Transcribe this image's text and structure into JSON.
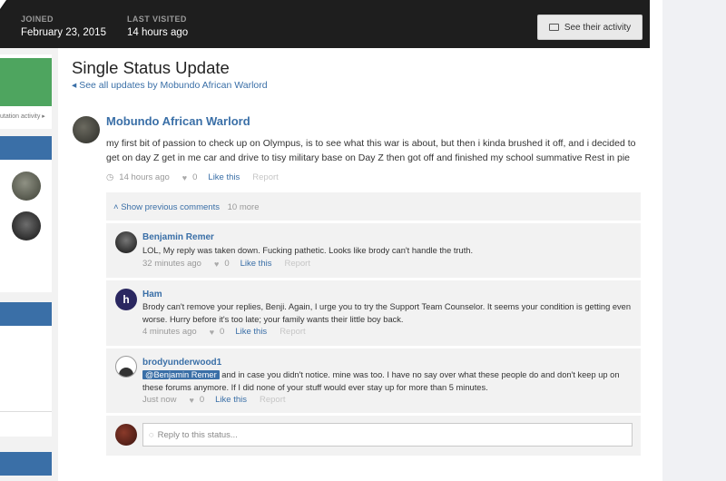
{
  "header": {
    "joined_label": "JOINED",
    "joined_value": "February 23, 2015",
    "last_visited_label": "LAST VISITED",
    "last_visited_value": "14 hours ago",
    "activity_button": "See their activity"
  },
  "sidebar": {
    "reputation_link": "utation activity ▸"
  },
  "page": {
    "title": "Single Status Update",
    "back_link": "◂ See all updates by Mobundo African Warlord"
  },
  "status": {
    "author": "Mobundo African Warlord",
    "text": "my first bit of passion to check up on Olympus, is to see what this war is about, but then i kinda brushed it off, and i decided to get on day Z  get in me car and drive to tisy military base on Day Z then got off  and finished my school summative Rest in pie",
    "time": "14 hours ago",
    "likes": "0",
    "like_label": "Like this",
    "report_label": "Report"
  },
  "comments": {
    "show_previous": "Show previous comments",
    "more_count": "10 more",
    "items": [
      {
        "author": "Benjamin Remer",
        "text": "LOL, My reply was taken down. Fucking pathetic. Looks like brody can't handle the truth.",
        "time": "32 minutes ago",
        "likes": "0",
        "like_label": "Like this",
        "report_label": "Report"
      },
      {
        "author": "Ham",
        "avatar_letter": "h",
        "text": "Brody can't remove your replies, Benji. Again, I urge you to try the Support Team Counselor. It seems your condition is getting even worse. Hurry before it's too late; your family wants their little boy back.",
        "time": "4 minutes ago",
        "likes": "0",
        "like_label": "Like this",
        "report_label": "Report"
      },
      {
        "author": "brodyunderwood1",
        "mention": "@Benjamin Remer",
        "text": " and in case you didn't notice. mine was too.  I have no say over what these people do and don't keep up on these forums anymore.  If I did none of your stuff would ever stay up for more than 5 minutes.",
        "time": "Just now",
        "likes": "0",
        "like_label": "Like this",
        "report_label": "Report"
      }
    ],
    "reply_placeholder": "Reply to this status..."
  },
  "colors": {
    "accent": "#3a6fa7",
    "header_bg": "#1e1e1e",
    "green": "#4ea55f"
  }
}
